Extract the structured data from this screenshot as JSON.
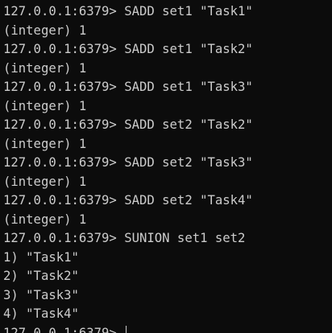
{
  "terminal": {
    "lines": [
      "127.0.0.1:6379> SADD set1 \"Task1\"",
      "(integer) 1",
      "127.0.0.1:6379> SADD set1 \"Task2\"",
      "(integer) 1",
      "127.0.0.1:6379> SADD set1 \"Task3\"",
      "(integer) 1",
      "127.0.0.1:6379> SADD set2 \"Task2\"",
      "(integer) 1",
      "127.0.0.1:6379> SADD set2 \"Task3\"",
      "(integer) 1",
      "127.0.0.1:6379> SADD set2 \"Task4\"",
      "(integer) 1",
      "127.0.0.1:6379> SUNION set1 set2",
      "1) \"Task1\"",
      "2) \"Task2\"",
      "3) \"Task3\"",
      "4) \"Task4\""
    ],
    "prompt": "127.0.0.1:6379> ",
    "colors": {
      "background": "#0c0c0c",
      "text": "#cccccc"
    }
  }
}
